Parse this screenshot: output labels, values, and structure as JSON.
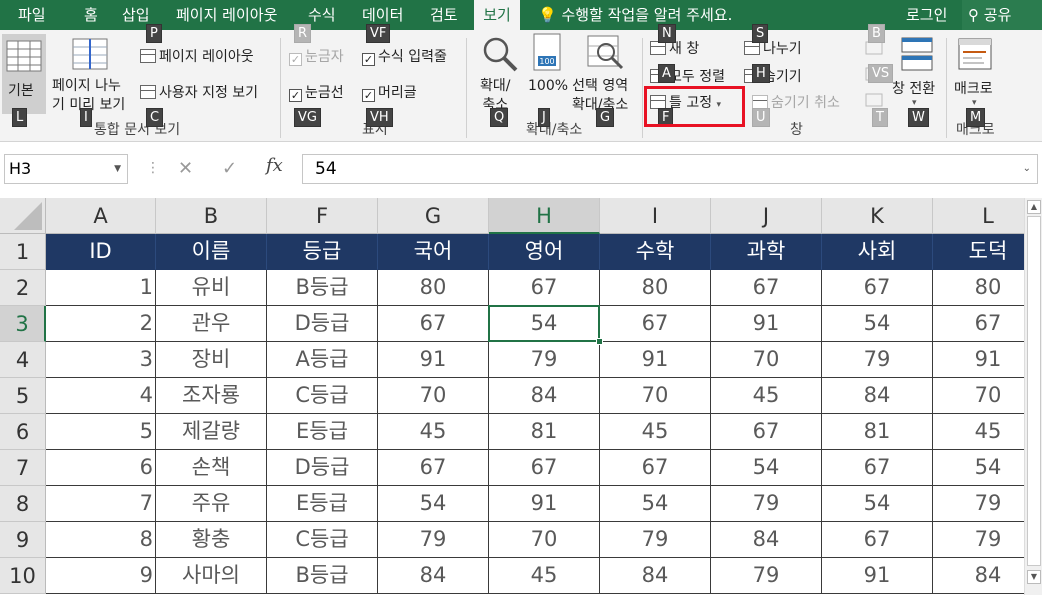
{
  "tabs": [
    {
      "label": "파일",
      "active": false
    },
    {
      "label": "홈",
      "active": false
    },
    {
      "label": "삽입",
      "active": false
    },
    {
      "label": "페이지 레이아웃",
      "active": false
    },
    {
      "label": "수식",
      "active": false
    },
    {
      "label": "데이터",
      "active": false
    },
    {
      "label": "검토",
      "active": false
    },
    {
      "label": "보기",
      "active": true
    }
  ],
  "tellme": "수행할 작업을 알려 주세요.",
  "login": "로그인",
  "share": "공유",
  "ribbon": {
    "workbook_views": {
      "normal": "기본",
      "page_break_line1": "페이지 나누",
      "page_break_line2": "기 미리 보기",
      "page_layout": "페이지 레이아웃",
      "custom_views": "사용자 지정 보기",
      "group": "통합 문서 보기"
    },
    "show": {
      "ruler": "눈금자",
      "formula_bar": "수식 입력줄",
      "gridlines": "눈금선",
      "headings": "머리글",
      "group": "표시"
    },
    "zoom": {
      "zoom_line1": "확대/",
      "zoom_line2": "축소",
      "zoom100": "100%",
      "zoom_sel_line1": "선택 영역",
      "zoom_sel_line2": "확대/축소",
      "zoom100_icon_text": "100",
      "group": "확대/축소"
    },
    "window": {
      "new_window": "새 창",
      "arrange_all": "모두 정렬",
      "freeze_panes": "틀 고정",
      "split": "나누기",
      "hide": "숨기기",
      "unhide": "숨기기 취소",
      "switch_windows": "창 전환",
      "group": "창"
    },
    "macros": {
      "macros": "매크로",
      "group": "매크로"
    }
  },
  "keytips": {
    "P": "P",
    "R": "R",
    "VF": "VF",
    "N": "N",
    "S": "S",
    "B": "B",
    "VS": "VS",
    "A": "A",
    "H": "H",
    "L": "L",
    "I": "I",
    "C": "C",
    "VG": "VG",
    "VH": "VH",
    "Q": "Q",
    "J": "J",
    "G": "G",
    "F": "F",
    "U": "U",
    "T": "T",
    "W": "W",
    "M": "M"
  },
  "formula_bar": {
    "name_box": "H3",
    "fx": "fx",
    "content": "54"
  },
  "sheet": {
    "columns": [
      "A",
      "B",
      "F",
      "G",
      "H",
      "I",
      "J",
      "K",
      "L"
    ],
    "selected_column": "H",
    "selected_row": "3",
    "rows": [
      "1",
      "2",
      "3",
      "4",
      "5",
      "6",
      "7",
      "8",
      "9",
      "10"
    ],
    "header_row": [
      "ID",
      "이름",
      "등급",
      "국어",
      "영어",
      "수학",
      "과학",
      "사회",
      "도덕"
    ],
    "data": [
      [
        "1",
        "유비",
        "B등급",
        "80",
        "67",
        "80",
        "67",
        "67",
        "80"
      ],
      [
        "2",
        "관우",
        "D등급",
        "67",
        "54",
        "67",
        "91",
        "54",
        "67"
      ],
      [
        "3",
        "장비",
        "A등급",
        "91",
        "79",
        "91",
        "70",
        "79",
        "91"
      ],
      [
        "4",
        "조자룡",
        "C등급",
        "70",
        "84",
        "70",
        "45",
        "84",
        "70"
      ],
      [
        "5",
        "제갈량",
        "E등급",
        "45",
        "81",
        "45",
        "67",
        "81",
        "45"
      ],
      [
        "6",
        "손책",
        "D등급",
        "67",
        "67",
        "67",
        "54",
        "67",
        "54"
      ],
      [
        "7",
        "주유",
        "E등급",
        "54",
        "91",
        "54",
        "79",
        "54",
        "79"
      ],
      [
        "8",
        "황충",
        "C등급",
        "79",
        "70",
        "79",
        "84",
        "67",
        "79"
      ],
      [
        "9",
        "사마의",
        "B등급",
        "84",
        "45",
        "84",
        "79",
        "91",
        "84"
      ]
    ]
  },
  "colors": {
    "excel_green": "#217346",
    "header_fill": "#1f3864",
    "highlight_box": "#e81123"
  }
}
